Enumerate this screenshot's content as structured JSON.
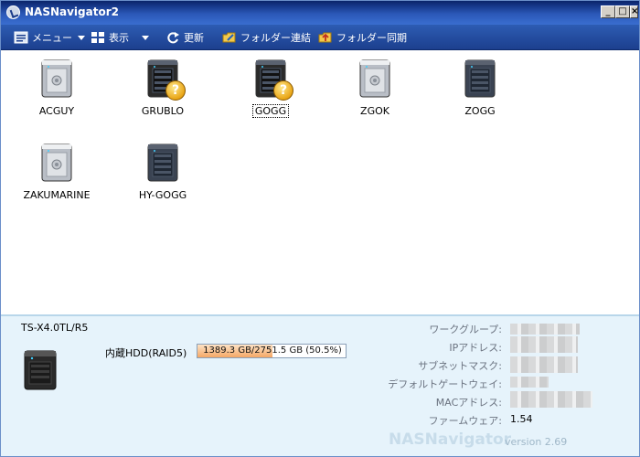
{
  "window": {
    "title": "NASNavigator2",
    "controls": {
      "minimize": "_",
      "maximize": "□",
      "close": "×"
    }
  },
  "toolbar": {
    "menu": {
      "label": "メニュー",
      "icon": "menu-icon"
    },
    "view": {
      "label": "表示",
      "icon": "view-icon"
    },
    "refresh": {
      "label": "更新",
      "icon": "refresh-icon"
    },
    "folder_link": {
      "label": "フォルダー連結",
      "icon": "folder-link-icon"
    },
    "folder_sync": {
      "label": "フォルダー同期",
      "icon": "folder-sync-icon"
    }
  },
  "devices": [
    {
      "name": "ACGUY",
      "style": "silver",
      "unknown": false,
      "selected": false
    },
    {
      "name": "GRUBLO",
      "style": "black",
      "unknown": true,
      "selected": false
    },
    {
      "name": "GOGG",
      "style": "black",
      "unknown": true,
      "selected": true
    },
    {
      "name": "ZGOK",
      "style": "silver",
      "unknown": false,
      "selected": false
    },
    {
      "name": "ZOGG",
      "style": "dark",
      "unknown": false,
      "selected": false
    },
    {
      "name": "ZAKUMARINE",
      "style": "silver",
      "unknown": false,
      "selected": false
    },
    {
      "name": "HY-GOGG",
      "style": "dark",
      "unknown": false,
      "selected": false
    }
  ],
  "info": {
    "model": "TS-X4.0TL/R5",
    "hdd_label": "内蔵HDD(RAID5)",
    "hdd_usage_text": "1389.3 GB/2751.5 GB (50.5%)",
    "hdd_usage_fraction": 0.505,
    "props": {
      "workgroup_label": "ワークグループ:",
      "ip_label": "IPアドレス:",
      "subnet_label": "サブネットマスク:",
      "gateway_label": "デフォルトゲートウェイ:",
      "mac_label": "MACアドレス:",
      "firmware_label": "ファームウェア:",
      "firmware_value": "1.54"
    },
    "brand": "NASNavigator",
    "version": "version 2.69"
  }
}
